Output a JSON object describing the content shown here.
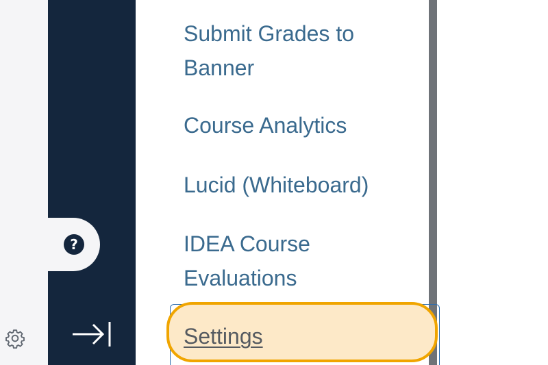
{
  "course_nav": {
    "items": [
      {
        "label_line1": "Submit Grades to",
        "label_line2": "Banner"
      },
      {
        "label": "Course Analytics"
      },
      {
        "label": "Lucid (Whiteboard)"
      },
      {
        "label_line1": "IDEA Course",
        "label_line2": "Evaluations"
      },
      {
        "label": "Settings",
        "highlighted": true
      }
    ]
  },
  "global_nav": {
    "help_icon": "?",
    "icons": [
      "help-icon",
      "collapse-nav-icon",
      "gear-icon"
    ]
  },
  "colors": {
    "nav_dark": "#14263d",
    "link": "#3a6a8e",
    "highlight_border": "#f0a500",
    "highlight_fill": "#fde9c8"
  }
}
